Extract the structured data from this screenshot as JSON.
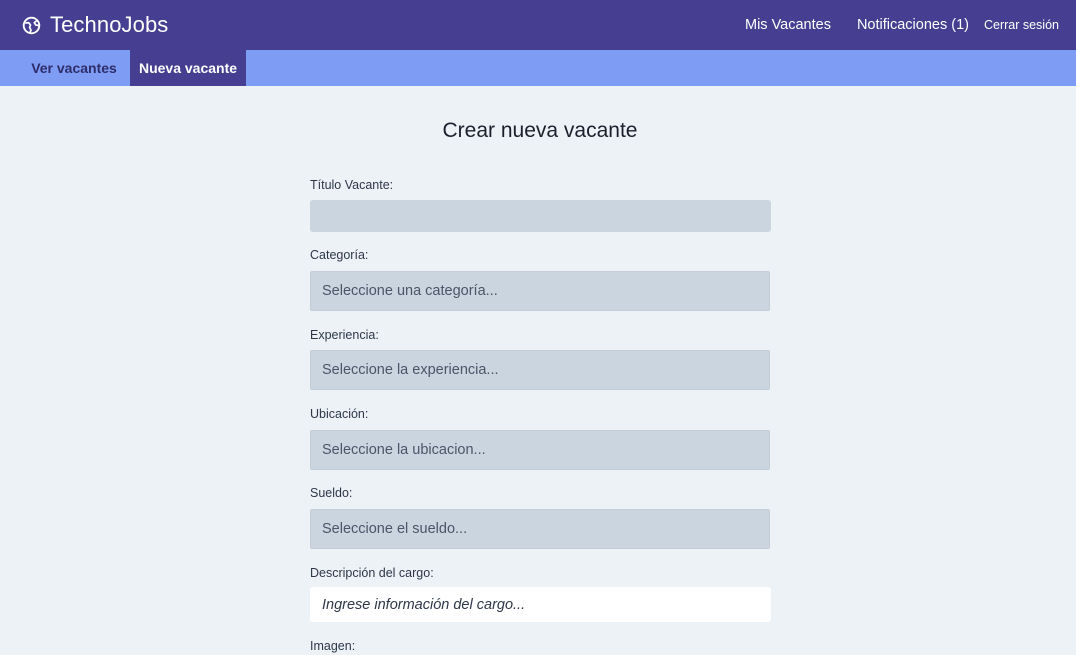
{
  "header": {
    "brand": "TechnoJobs",
    "brand_icon": "browser-logo-icon",
    "nav": {
      "my_vacancies": "Mis Vacantes",
      "notifications": "Notificaciones (1)",
      "logout": "Cerrar sesión"
    }
  },
  "subnav": {
    "tabs": [
      {
        "label": "Ver vacantes",
        "active": false
      },
      {
        "label": "Nueva vacante",
        "active": true
      }
    ]
  },
  "form": {
    "title": "Crear nueva vacante",
    "title_field": {
      "label": "Título Vacante:",
      "value": ""
    },
    "category": {
      "label": "Categoría:",
      "selected": "Seleccione una categoría..."
    },
    "experience": {
      "label": "Experiencia:",
      "selected": "Seleccione la experiencia..."
    },
    "location": {
      "label": "Ubicación:",
      "selected": "Seleccione la ubicacion..."
    },
    "salary": {
      "label": "Sueldo:",
      "selected": "Seleccione el sueldo..."
    },
    "description": {
      "label": "Descripción del cargo:",
      "placeholder": "Ingrese información del cargo..."
    },
    "image": {
      "label": "Imagen:"
    }
  },
  "colors": {
    "topbar": "#463f91",
    "subbar": "#7f9cf5",
    "background": "#edf2f7",
    "input_fill": "#cbd5e0"
  }
}
